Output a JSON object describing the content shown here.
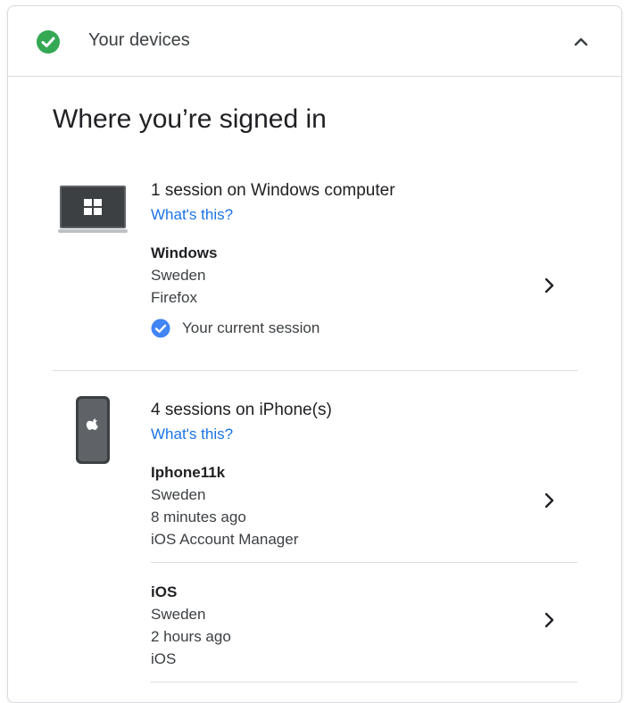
{
  "header": {
    "title": "Your devices",
    "check_icon": "check-circle-icon",
    "collapse_icon": "chevron-up-icon"
  },
  "section_title": "Where you’re signed in",
  "colors": {
    "link": "#1a73e8",
    "success": "#34a853",
    "current": "#4285f4"
  },
  "groups": [
    {
      "icon": "windows-laptop-icon",
      "title": "1 session on Windows computer",
      "link": "What's this?",
      "sessions": [
        {
          "name": "Windows",
          "lines": [
            "Sweden",
            "Firefox"
          ],
          "current_label": "Your current session"
        }
      ]
    },
    {
      "icon": "iphone-icon",
      "title": "4 sessions on iPhone(s)",
      "link": "What's this?",
      "sessions": [
        {
          "name": "Iphone11k",
          "lines": [
            "Sweden",
            "8 minutes ago",
            "iOS Account Manager"
          ]
        },
        {
          "name": "iOS",
          "lines": [
            "Sweden",
            "2 hours ago",
            "iOS"
          ]
        }
      ]
    }
  ]
}
